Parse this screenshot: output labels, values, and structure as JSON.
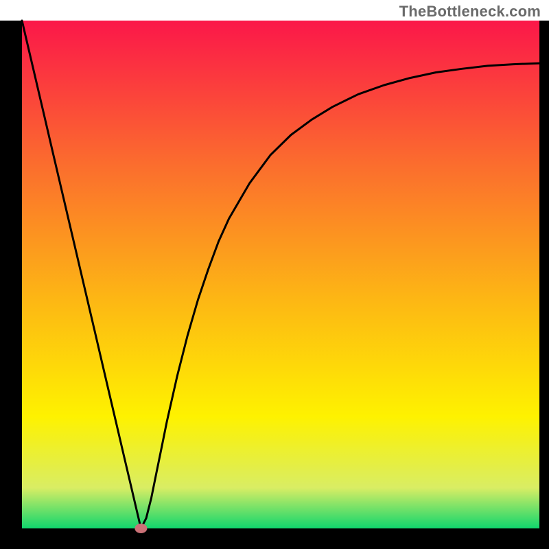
{
  "watermark": "TheBottleneck.com",
  "chart_data": {
    "type": "line",
    "title": "",
    "xlabel": "",
    "ylabel": "",
    "xlim": [
      0,
      100
    ],
    "ylim": [
      0,
      100
    ],
    "grid": false,
    "legend": false,
    "x": [
      0,
      2,
      4,
      6,
      8,
      10,
      12,
      14,
      16,
      18,
      20,
      21,
      22,
      23,
      24,
      25,
      26,
      27,
      28,
      30,
      32,
      34,
      36,
      38,
      40,
      44,
      48,
      52,
      56,
      60,
      65,
      70,
      75,
      80,
      85,
      90,
      95,
      100
    ],
    "values": [
      100.0,
      91.3,
      82.6,
      73.9,
      65.2,
      56.5,
      47.8,
      39.1,
      30.4,
      21.7,
      13.0,
      8.7,
      4.3,
      0.0,
      2.0,
      6.0,
      11.0,
      16.0,
      21.0,
      30.0,
      38.0,
      45.0,
      51.0,
      56.5,
      61.0,
      68.0,
      73.5,
      77.5,
      80.5,
      83.0,
      85.5,
      87.3,
      88.7,
      89.8,
      90.5,
      91.1,
      91.4,
      91.6
    ],
    "min_point": {
      "x": 23,
      "y": 0
    },
    "gradient_colors": {
      "top": "#fb1749",
      "upper_mid": "#fb6c2e",
      "mid": "#fdb714",
      "lower_mid": "#fef200",
      "near_bottom": "#d9ed64",
      "bottom": "#10d66d"
    },
    "curve_color": "#000000",
    "frame_color": "#000000",
    "marker_color": "#cb7177"
  }
}
